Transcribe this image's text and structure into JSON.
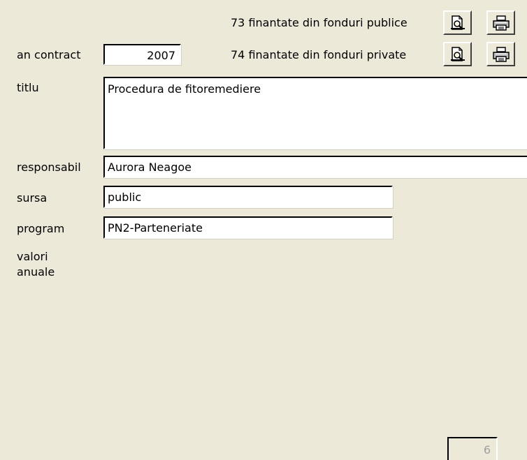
{
  "reports": [
    {
      "label": "73 finantate din fonduri publice",
      "preview_icon": "print-preview-icon",
      "print_icon": "printer-icon"
    },
    {
      "label": "74 finantate din fonduri private",
      "preview_icon": "print-preview-icon",
      "print_icon": "printer-icon"
    }
  ],
  "form": {
    "an_contract_label": "an contract",
    "an_contract_value": "2007",
    "titlu_label": "titlu",
    "titlu_value": "Procedura de fitoremediere",
    "responsabil_label": "responsabil",
    "responsabil_value": "Aurora Neagoe",
    "sursa_label": "sursa",
    "sursa_value": "public",
    "program_label": "program",
    "program_value": "PN2-Parteneriate",
    "valori_label_line1": "valori",
    "valori_label_line2": "anuale"
  },
  "pager": {
    "value": "6"
  }
}
